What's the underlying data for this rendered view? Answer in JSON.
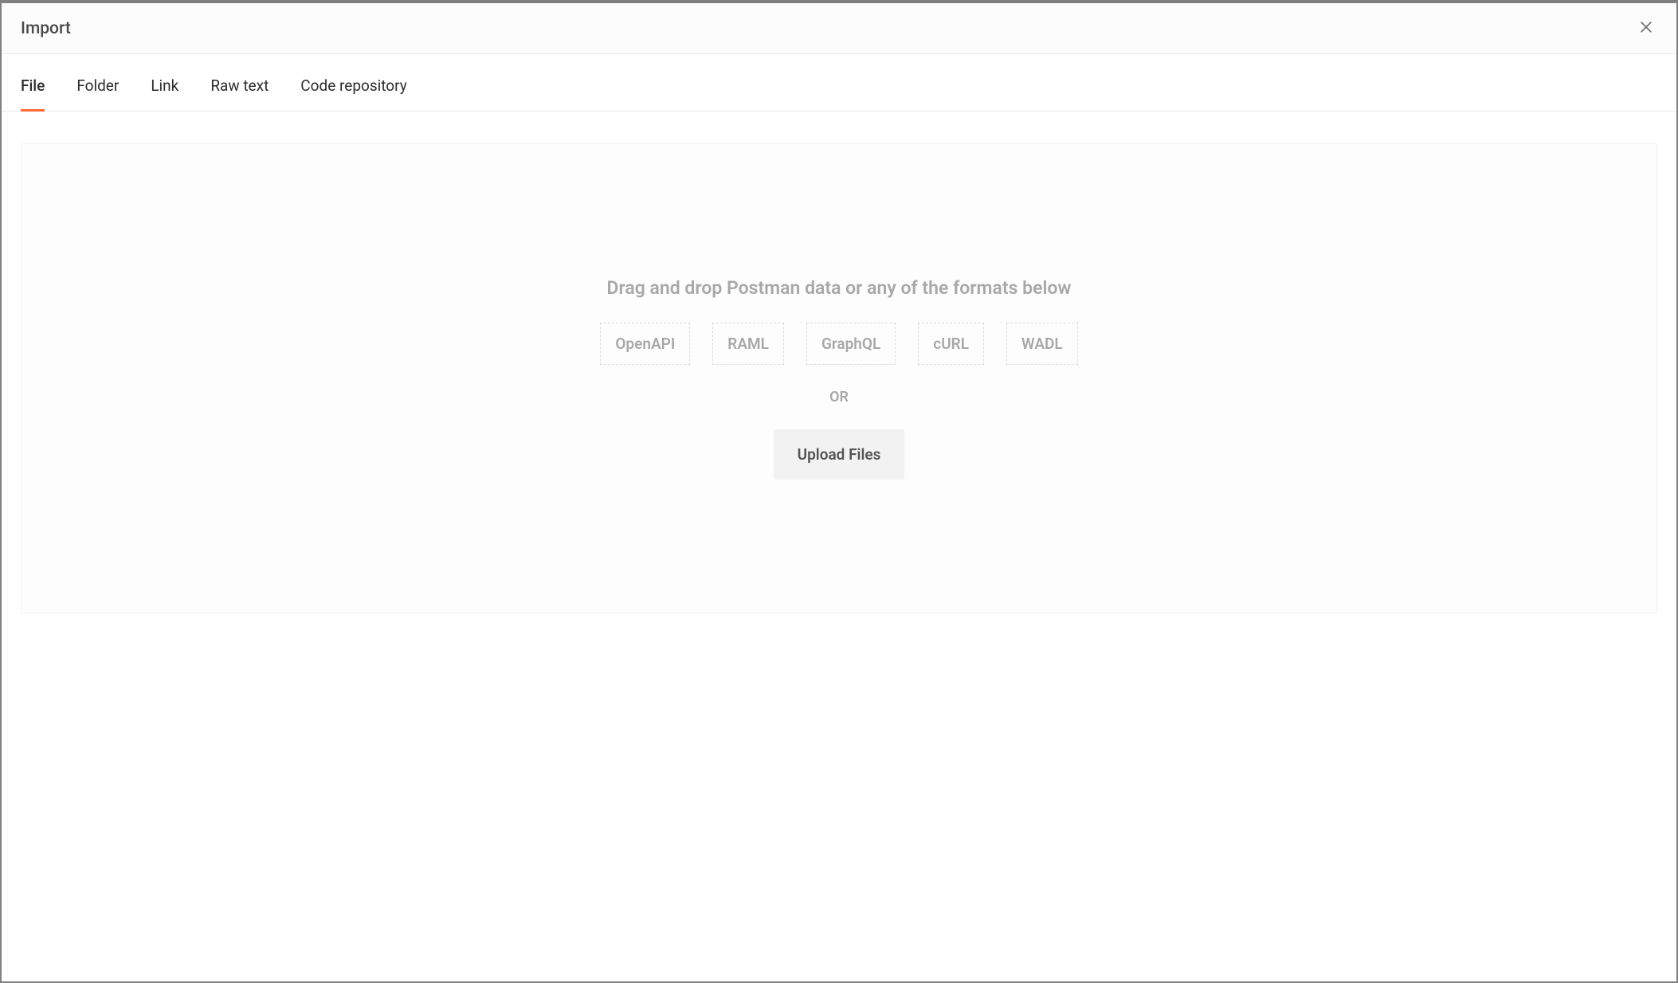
{
  "header": {
    "title": "Import"
  },
  "tabs": {
    "items": [
      {
        "label": "File",
        "active": true
      },
      {
        "label": "Folder",
        "active": false
      },
      {
        "label": "Link",
        "active": false
      },
      {
        "label": "Raw text",
        "active": false
      },
      {
        "label": "Code repository",
        "active": false
      }
    ]
  },
  "dropzone": {
    "message": "Drag and drop Postman data or any of the formats below",
    "formats": [
      "OpenAPI",
      "RAML",
      "GraphQL",
      "cURL",
      "WADL"
    ],
    "separator": "OR",
    "upload_label": "Upload Files"
  },
  "colors": {
    "accent": "#ff6c37"
  }
}
